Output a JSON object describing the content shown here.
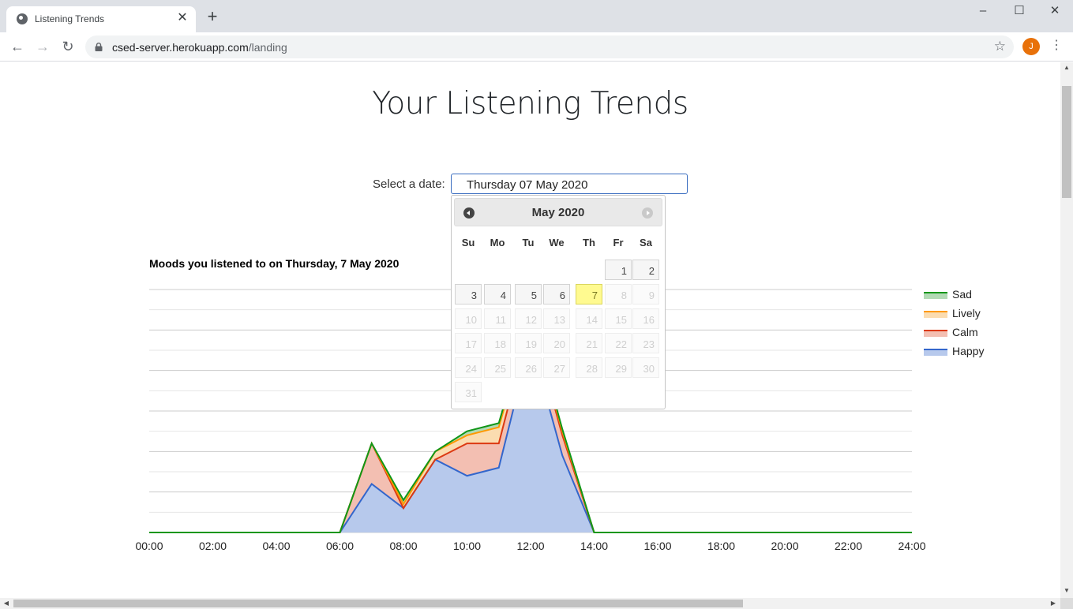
{
  "browser": {
    "tab_title": "Listening Trends",
    "new_tab": "+",
    "close_tab": "✕",
    "url_host": "csed-server.herokuapp.com",
    "url_path": "/landing",
    "avatar_letter": "J",
    "window_minimize": "–",
    "window_maximize": "☐",
    "window_close": "✕"
  },
  "page": {
    "title": "Your Listening Trends",
    "date_label": "Select a date:",
    "date_value": "Thursday 07 May 2020"
  },
  "datepicker": {
    "month_title": "May 2020",
    "weekdays": [
      "Su",
      "Mo",
      "Tu",
      "We",
      "Th",
      "Fr",
      "Sa"
    ],
    "days_in_month": 31,
    "first_weekday_index": 5,
    "selected_day": 7,
    "last_enabled_day": 7
  },
  "chart_data": {
    "type": "area",
    "title": "Moods you listened to on Thursday, 7 May 2020",
    "xlabel": "",
    "ylabel": "",
    "x_tick_labels": [
      "00:00",
      "02:00",
      "04:00",
      "06:00",
      "08:00",
      "10:00",
      "12:00",
      "14:00",
      "16:00",
      "18:00",
      "20:00",
      "22:00",
      "24:00"
    ],
    "xlim": [
      0,
      24
    ],
    "ylim": [
      0,
      12
    ],
    "stacked": true,
    "grid": true,
    "legend_position": "right",
    "x": [
      0,
      1,
      2,
      3,
      4,
      5,
      6,
      7,
      8,
      9,
      10,
      11,
      12,
      13,
      14,
      15,
      16,
      17,
      18,
      19,
      20,
      21,
      22,
      23,
      24
    ],
    "series": [
      {
        "name": "Happy",
        "color": "#3366cc",
        "fill": "#b7c9ec",
        "values": [
          0,
          0,
          0,
          0,
          0,
          0,
          0,
          2.4,
          1.2,
          3.6,
          2.8,
          3.2,
          9.5,
          3.8,
          0,
          0,
          0,
          0,
          0,
          0,
          0,
          0,
          0,
          0,
          0
        ]
      },
      {
        "name": "Calm",
        "color": "#dc3912",
        "fill": "#f3bfb2",
        "values": [
          0,
          0,
          0,
          0,
          0,
          0,
          0,
          2.0,
          0,
          0,
          1.6,
          1.2,
          1.0,
          1.0,
          0,
          0,
          0,
          0,
          0,
          0,
          0,
          0,
          0,
          0,
          0
        ]
      },
      {
        "name": "Lively",
        "color": "#ff9900",
        "fill": "#fbdcb0",
        "values": [
          0,
          0,
          0,
          0,
          0,
          0,
          0,
          0,
          0.2,
          0.4,
          0.4,
          0.8,
          0.2,
          0.2,
          0,
          0,
          0,
          0,
          0,
          0,
          0,
          0,
          0,
          0,
          0
        ]
      },
      {
        "name": "Sad",
        "color": "#109618",
        "fill": "#b2dab4",
        "values": [
          0,
          0,
          0,
          0,
          0,
          0,
          0,
          0,
          0.2,
          0,
          0.2,
          0.2,
          0.1,
          0.1,
          0,
          0,
          0,
          0,
          0,
          0,
          0,
          0,
          0,
          0,
          0
        ]
      }
    ],
    "legend_order": [
      "Sad",
      "Lively",
      "Calm",
      "Happy"
    ]
  }
}
